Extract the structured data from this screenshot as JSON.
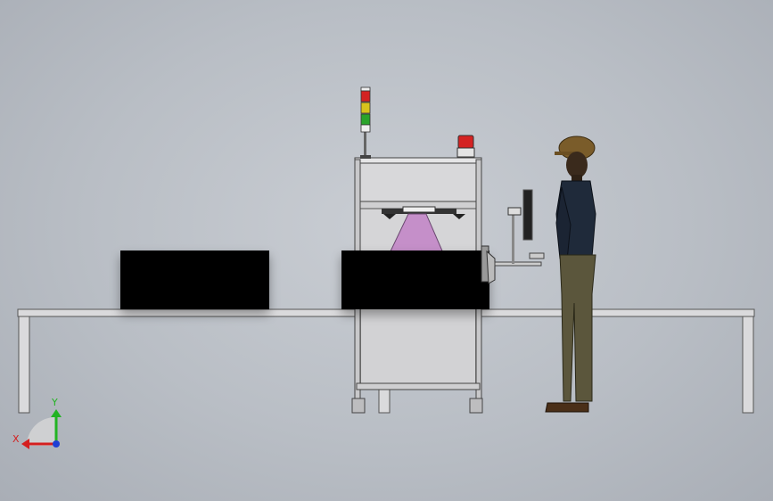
{
  "scene": {
    "view": "front-side",
    "axes": {
      "x_label": "X",
      "y_label": "Y"
    },
    "colors": {
      "background": "#bfc4cb",
      "frame": "#d9d9db",
      "frame_stroke": "#555",
      "black_box": "#000000",
      "pyramid": "#c58fc9",
      "tower_red": "#d42222",
      "tower_yellow": "#d8c21c",
      "tower_green": "#2aa32a",
      "axis_x": "#d41f1f",
      "axis_y": "#22b322",
      "axis_z": "#1f3fd4",
      "helmet": "#7a5c2a",
      "shirt": "#1f2a3a",
      "pants": "#5b563c"
    }
  }
}
